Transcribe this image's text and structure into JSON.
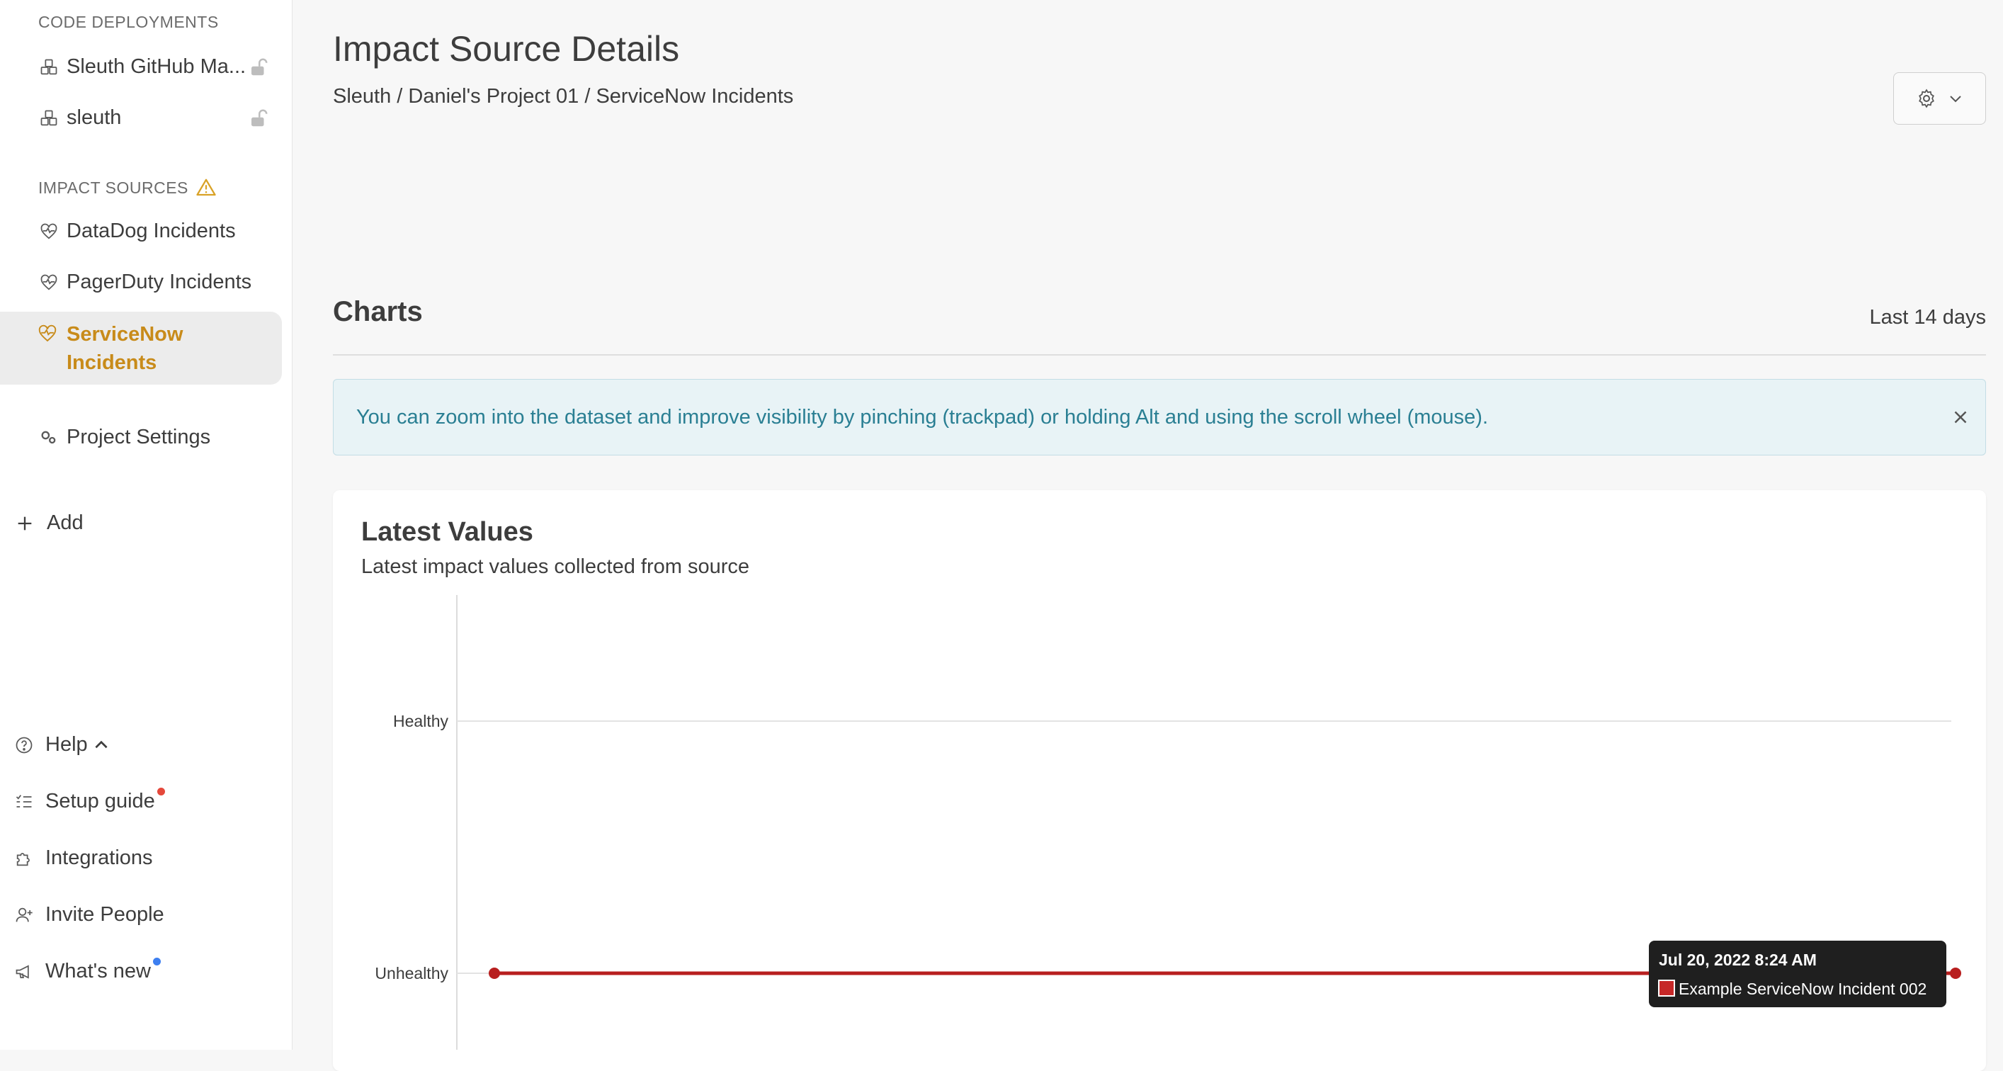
{
  "sidebar": {
    "code_deployments": {
      "label": "CODE DEPLOYMENTS",
      "items": [
        {
          "label": "Sleuth GitHub Ma...",
          "icon": "cubes-icon"
        },
        {
          "label": "sleuth",
          "icon": "cubes-icon"
        }
      ]
    },
    "impact_sources": {
      "label": "IMPACT SOURCES",
      "items": [
        {
          "label": "DataDog Incidents",
          "icon": "heart-pulse-icon"
        },
        {
          "label": "PagerDuty Incidents",
          "icon": "heart-pulse-icon"
        },
        {
          "label": "ServiceNow Incidents",
          "icon": "heart-pulse-icon",
          "active": true
        }
      ]
    },
    "project_settings": {
      "label": "Project Settings",
      "icon": "gears-icon"
    },
    "add": {
      "label": "Add",
      "icon": "plus-icon"
    },
    "bottom": {
      "help": "Help",
      "setup_guide": "Setup guide",
      "integrations": "Integrations",
      "invite_people": "Invite People",
      "whats_new": "What's new"
    },
    "colors": {
      "active": "#c88b1a",
      "notification_red": "#e5483b",
      "notification_blue": "#3d7ff0",
      "warning": "#d9a227"
    }
  },
  "header": {
    "title": "Impact Source Details",
    "breadcrumb": "Sleuth / Daniel's Project 01 / ServiceNow Incidents"
  },
  "charts": {
    "heading": "Charts",
    "range": "Last 14 days",
    "info_banner": "You can zoom into the dataset and improve visibility by pinching (trackpad) or holding Alt and using the scroll wheel (mouse)."
  },
  "latest_values": {
    "title": "Latest Values",
    "subtitle": "Latest impact values collected from source"
  },
  "chart_data": {
    "type": "line",
    "y_categories": [
      "Unhealthy",
      "Healthy"
    ],
    "series": [
      {
        "values": [
          "Unhealthy",
          "Unhealthy"
        ],
        "color": "#b81f1f"
      }
    ],
    "tooltip": {
      "title": "Jul 20, 2022 8:24 AM",
      "item": "Example ServiceNow Incident 002"
    },
    "grid": true
  }
}
